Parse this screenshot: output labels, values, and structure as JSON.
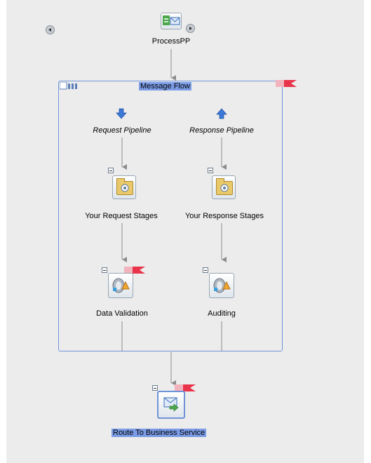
{
  "start_node": {
    "label": "ProcessPP"
  },
  "message_flow": {
    "label": "Message Flow"
  },
  "request_pipeline": {
    "label": "Request Pipeline"
  },
  "response_pipeline": {
    "label": "Response Pipeline"
  },
  "request_stage": {
    "label": "Your Request Stages"
  },
  "response_stage": {
    "label": "Your Response Stages"
  },
  "request_action": {
    "label": "Data Validation"
  },
  "response_action": {
    "label": "Auditing"
  },
  "route_node": {
    "label": "Route To Business Service"
  },
  "colors": {
    "canvas": "#ececec",
    "connector": "#8c8c8c",
    "flow_border": "#6f93d8",
    "selection_highlight": "#7b9ce6",
    "error_flag": "#e8334a"
  }
}
